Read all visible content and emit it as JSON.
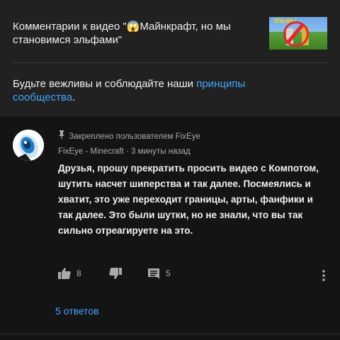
{
  "header": {
    "title": "Комментарии к видео \"😱Майнкрафт, но мы становимся эльфами\"",
    "thumbnail_icon": "video-thumbnail"
  },
  "guidelines": {
    "text": "Будьте вежливы и соблюдайте наши ",
    "link": "принципы сообщества",
    "suffix": "."
  },
  "comment": {
    "pinned_label": "Закреплено пользователем FixEye",
    "author": "FixEye",
    "channel": "Minecraft",
    "separator": "·",
    "time": "3 минуты назад",
    "text": "Друзья, прошу прекратить просить видео с Компотом, шутить насчет шиперства и так далее. Посмеялись и хватит, это уже переходит границы, арты, фанфики и так далее. Это были шутки, но не знали, что вы так сильно отреагируете на это.",
    "likes": "8",
    "replies_count": "5",
    "replies_link": "5 ответов"
  },
  "colors": {
    "background": "#141414",
    "header_background": "#212121",
    "link": "#3ea6ff",
    "secondary_text": "#aaaaaa"
  }
}
